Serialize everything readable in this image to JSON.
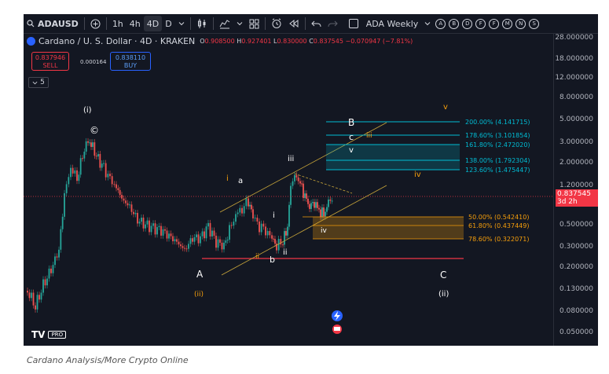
{
  "toolbar": {
    "search_label": "ADAUSD",
    "timeframes": [
      "1h",
      "4h",
      "4D",
      "D"
    ],
    "timeframe_active": "4D",
    "layout_name": "ADA Weekly",
    "circle_buttons": [
      "A",
      "B",
      "D",
      "F",
      "F",
      "M",
      "N",
      "S"
    ]
  },
  "header": {
    "title": "Cardano / U. S. Dollar · 4D · KRAKEN",
    "o_label": "O",
    "o_value": "0.908500",
    "h_label": "H",
    "h_value": "0.927401",
    "l_label": "L",
    "l_value": "0.830000",
    "c_label": "C",
    "c_value": "0.837545",
    "change": "−0.070947 (−7.81%)"
  },
  "trade": {
    "sell_price": "0.837946",
    "sell_label": "SELL",
    "spread": "0.000164",
    "buy_price": "0.838110",
    "buy_label": "BUY",
    "collapse_count": "5"
  },
  "price_axis": {
    "ticks": [
      "28.000000",
      "18.000000",
      "12.000000",
      "8.000000",
      "5.000000",
      "3.000000",
      "2.000000",
      "1.200000",
      "0.500000",
      "0.300000",
      "0.200000",
      "0.130000",
      "0.080000",
      "0.050000"
    ],
    "current_price": "0.837545",
    "countdown": "3d 2h"
  },
  "fib_upper": [
    "200.00% (4.141715)",
    "178.60% (3.101854)",
    "161.80% (2.472020)",
    "138.00% (1.792304)",
    "123.60% (1.475447)"
  ],
  "fib_lower": [
    "50.00% (0.542410)",
    "61.80% (0.437449)",
    "78.60% (0.322071)"
  ],
  "wave_labels": {
    "w_i": "(i)",
    "w_circle_c": "©",
    "w_A": "A",
    "w_ii_orange": "(ii)",
    "w_a": "a",
    "w_i_orange": "i",
    "w_ii_small_orange": "ii",
    "w_b": "b",
    "w_i_white": "i",
    "w_ii_white": "ii",
    "w_iii_white": "iii",
    "w_iv_white": "iv",
    "w_B": "B",
    "w_c": "c",
    "w_iii_orange": "iii",
    "w_v_white": "v",
    "w_iv_orange": "iv",
    "w_v_orange": "v",
    "w_C": "C",
    "w_ii_white_paren": "(ii)"
  },
  "colors": {
    "background": "#131722",
    "candle_up": "#26a69a",
    "candle_down": "#ef5350",
    "fib_upper": "#00bcd4",
    "fib_lower": "#f59e0b",
    "support": "#f23645",
    "accent": "#2962ff"
  },
  "brand": {
    "logo": "TV",
    "pro_badge": "PRO"
  },
  "caption": "Cardano Analysis/More Crypto Online"
}
